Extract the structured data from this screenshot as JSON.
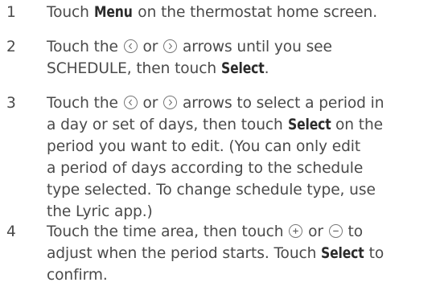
{
  "steps": [
    {
      "number": "1",
      "lines": [
        {
          "before": "Touch ",
          "bold": "Menu",
          "after": " on the thermostat home screen."
        }
      ]
    },
    {
      "number": "2",
      "line1": {
        "before": "Touch the ",
        "mid": " or ",
        "after": " arrows until you see"
      },
      "line2": {
        "before": "SCHEDULE, then touch ",
        "bold": "Select",
        "after": "."
      }
    },
    {
      "number": "3",
      "line1": {
        "before": "Touch the ",
        "mid": " or ",
        "after": " arrows to select a period in"
      },
      "line2": {
        "before": "a day or set of days, then touch ",
        "bold": "Select",
        "after": " on the"
      },
      "line3": "period you want to edit. (You can only edit",
      "line4": "a period of days according to the schedule",
      "line5": "type selected. To change schedule type, use",
      "line6": "the Lyric app.)"
    },
    {
      "number": "4",
      "line1": {
        "before": "Touch the time area, then touch ",
        "mid": " or ",
        "after": " to"
      },
      "line2": {
        "before": "adjust when the period starts. Touch ",
        "bold": "Select",
        "after": " to"
      },
      "line3": "confirm."
    }
  ],
  "icons": {
    "left": "left-arrow-circle-icon",
    "right": "right-arrow-circle-icon",
    "plus": "plus-circle-icon",
    "minus": "minus-circle-icon"
  }
}
